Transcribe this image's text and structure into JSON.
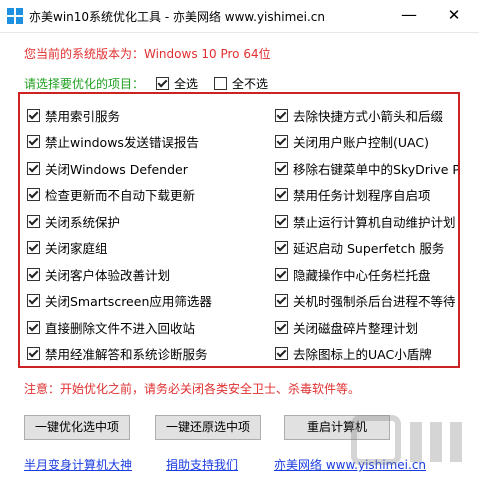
{
  "window": {
    "title": "亦美win10系统优化工具 - 亦美网络 www.yishimei.cn",
    "minimize_glyph": "—",
    "close_glyph": "✕"
  },
  "version_text": "您当前的系统版本为：Windows 10 Pro  64位",
  "select": {
    "prompt": "请选择要优化的项目：",
    "all_label": "全选",
    "all_checked": true,
    "none_label": "全不选",
    "none_checked": false
  },
  "left_items": [
    {
      "label": "禁用索引服务",
      "checked": true
    },
    {
      "label": "禁止windows发送错误报告",
      "checked": true
    },
    {
      "label": "关闭Windows Defender",
      "checked": true
    },
    {
      "label": "检查更新而不自动下载更新",
      "checked": true
    },
    {
      "label": "关闭系统保护",
      "checked": true
    },
    {
      "label": "关闭家庭组",
      "checked": true
    },
    {
      "label": "关闭客户体验改善计划",
      "checked": true
    },
    {
      "label": "关闭Smartscreen应用筛选器",
      "checked": true
    },
    {
      "label": "直接删除文件不进入回收站",
      "checked": true
    },
    {
      "label": "禁用经准解答和系统诊断服务",
      "checked": true
    }
  ],
  "right_items": [
    {
      "label": "去除快捷方式小箭头和后缀",
      "checked": true
    },
    {
      "label": "关闭用户账户控制(UAC)",
      "checked": true
    },
    {
      "label": "移除右键菜单中的SkyDrive Pro",
      "checked": true
    },
    {
      "label": "禁用任务计划程序自启项",
      "checked": true
    },
    {
      "label": "禁止运行计算机自动维护计划",
      "checked": true
    },
    {
      "label": "延迟启动 Superfetch 服务",
      "checked": true
    },
    {
      "label": "隐藏操作中心任务栏托盘",
      "checked": true
    },
    {
      "label": "关机时强制杀后台进程不等待",
      "checked": true
    },
    {
      "label": "关闭磁盘碎片整理计划",
      "checked": true
    },
    {
      "label": "去除图标上的UAC小盾牌",
      "checked": true
    }
  ],
  "warning": "注意：开始优化之前，请务必关闭各类安全卫士、杀毒软件等。",
  "buttons": {
    "optimize": "一键优化选中项",
    "restore": "一键还原选中项",
    "restart": "重启计算机"
  },
  "links": {
    "tutorial": "半月变身计算机大神",
    "donate": "捐助支持我们",
    "site": "亦美网络 www.yishimei.cn"
  },
  "colors": {
    "red": "#e03030",
    "green": "#20a020",
    "link": "#1a3ce0",
    "panel_border": "#cc2222"
  }
}
